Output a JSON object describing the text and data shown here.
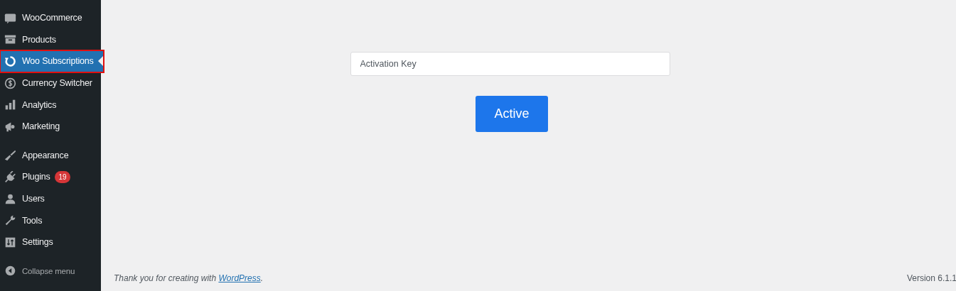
{
  "sidebar": {
    "groups": [
      [
        {
          "label": "WooCommerce",
          "selected": false,
          "outlined": false
        },
        {
          "label": "Products",
          "selected": false,
          "outlined": false
        },
        {
          "label": "Woo Subscriptions",
          "selected": true,
          "outlined": true
        },
        {
          "label": "Currency Switcher",
          "selected": false,
          "outlined": false
        },
        {
          "label": "Analytics",
          "selected": false,
          "outlined": false
        },
        {
          "label": "Marketing",
          "selected": false,
          "outlined": false
        }
      ],
      [
        {
          "label": "Appearance",
          "selected": false,
          "outlined": false
        },
        {
          "label": "Plugins",
          "selected": false,
          "outlined": false,
          "badge": "19"
        },
        {
          "label": "Users",
          "selected": false,
          "outlined": false
        },
        {
          "label": "Tools",
          "selected": false,
          "outlined": false
        },
        {
          "label": "Settings",
          "selected": false,
          "outlined": false
        }
      ]
    ],
    "collapse": "Collapse menu"
  },
  "activation": {
    "placeholder": "Activation Key",
    "button": "Active"
  },
  "footer": {
    "before": "Thank you for creating with",
    "link": "WordPress",
    "after": ".",
    "version": "Version 6.1.1"
  }
}
